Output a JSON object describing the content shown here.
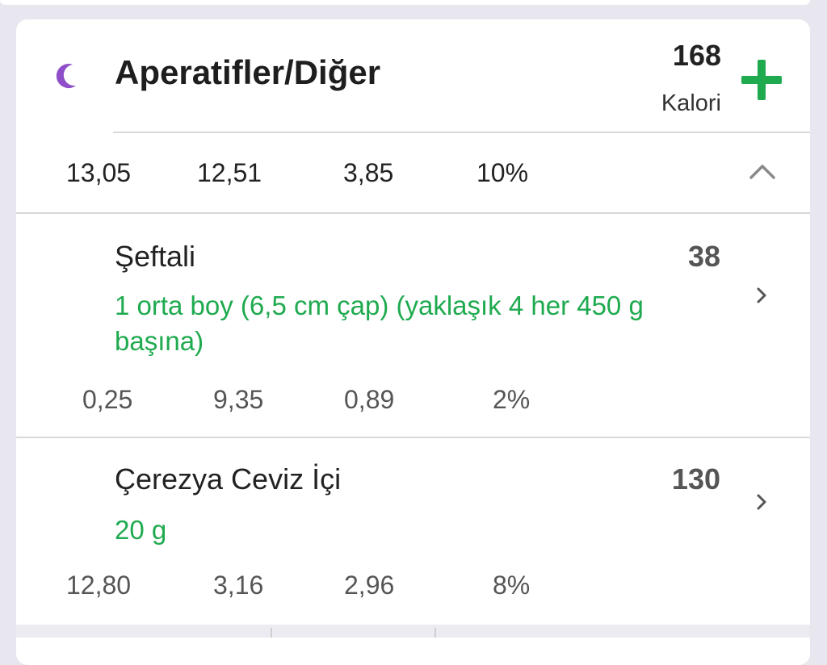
{
  "meal": {
    "title": "Aperatifler/Diğer",
    "icon": "moon-icon",
    "total_calories": "168",
    "calories_label": "Kalori",
    "macros": [
      "13,05",
      "12,51",
      "3,85",
      "10%"
    ]
  },
  "foods": [
    {
      "name": "Şeftali",
      "calories": "38",
      "portion": "1  orta boy (6,5 cm çap) (yaklaşık 4 her 450 g başına)",
      "macros": [
        "0,25",
        "9,35",
        "0,89",
        "2%"
      ]
    },
    {
      "name": "Çerezya Ceviz İçi",
      "calories": "130",
      "portion": "20  g",
      "macros": [
        "12,80",
        "3,16",
        "2,96",
        "8%"
      ]
    }
  ],
  "colors": {
    "accent_green": "#1faa4f",
    "moon_purple": "#8e4fc8",
    "background": "#e8e6ee"
  }
}
